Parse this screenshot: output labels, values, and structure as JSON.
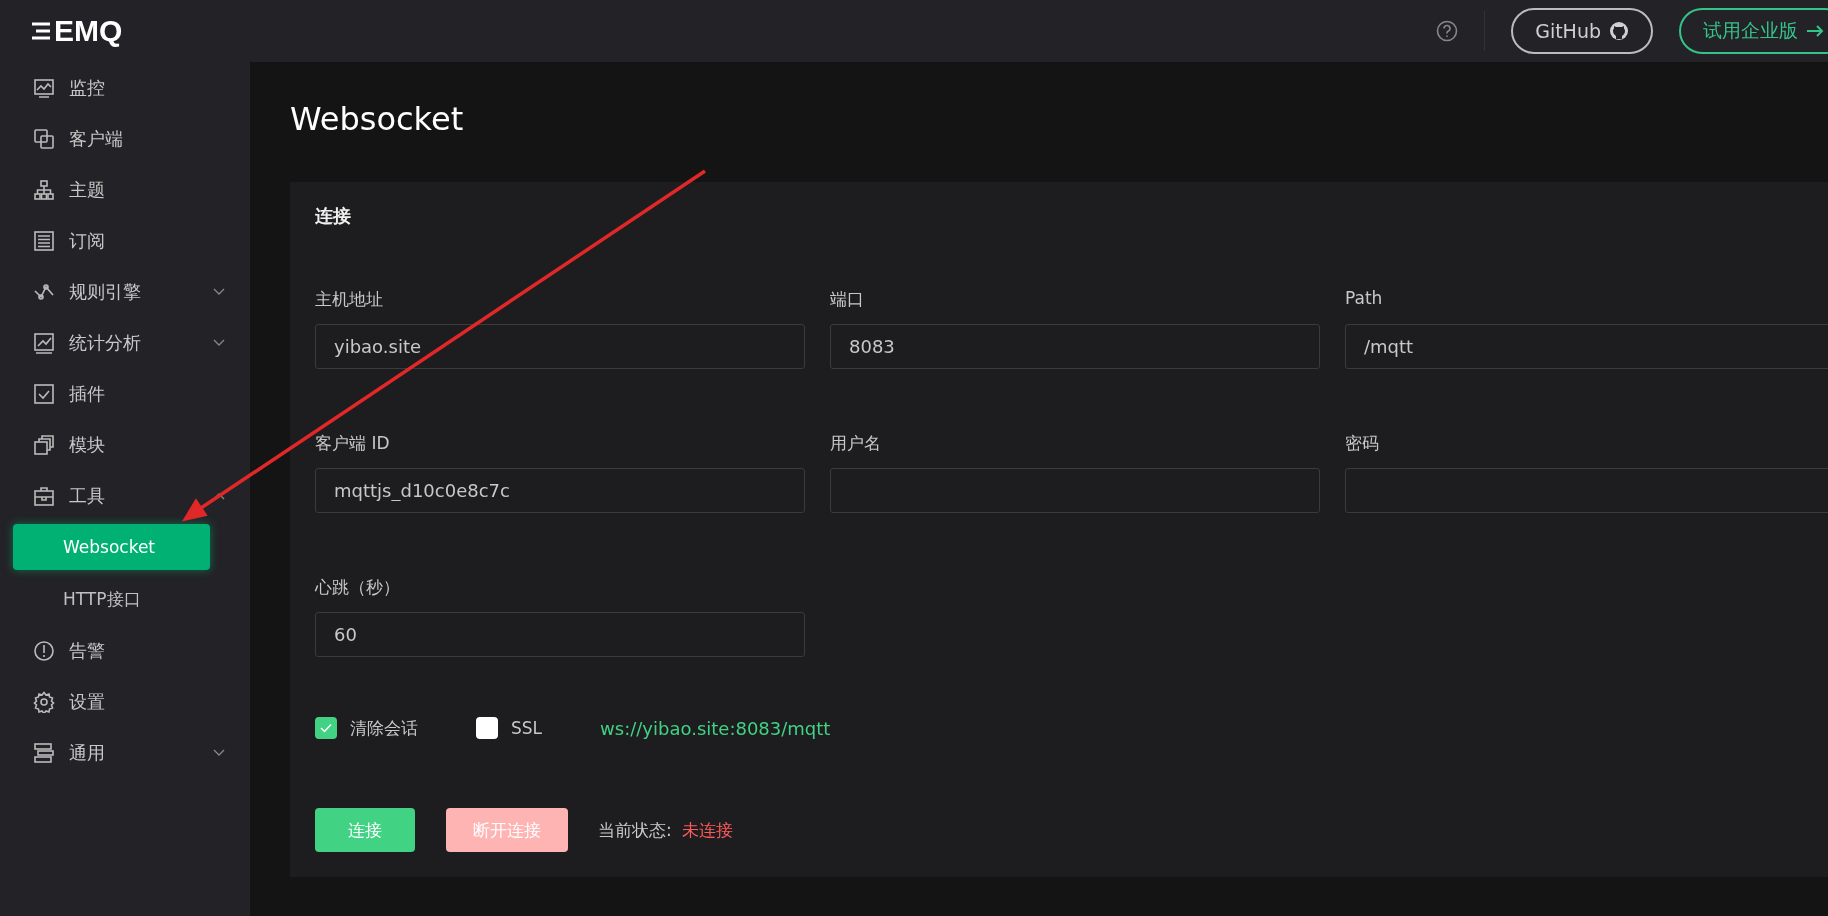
{
  "logo": "EMQ",
  "sidebar": {
    "items": [
      {
        "label": "监控"
      },
      {
        "label": "客户端"
      },
      {
        "label": "主题"
      },
      {
        "label": "订阅"
      },
      {
        "label": "规则引擎",
        "expanded": false
      },
      {
        "label": "统计分析",
        "expanded": false
      },
      {
        "label": "插件"
      },
      {
        "label": "模块"
      },
      {
        "label": "工具",
        "expanded": true,
        "children": [
          {
            "label": "Websocket",
            "selected": true
          },
          {
            "label": "HTTP接口",
            "selected": false
          }
        ]
      },
      {
        "label": "告警"
      },
      {
        "label": "设置"
      },
      {
        "label": "通用",
        "expanded": false
      }
    ]
  },
  "topbar": {
    "github": "GitHub",
    "trial": "试用企业版"
  },
  "page_title": "Websocket",
  "card": {
    "title": "连接",
    "fields": [
      {
        "label": "主机地址",
        "value": "yibao.site"
      },
      {
        "label": "端口",
        "value": "8083"
      },
      {
        "label": "Path",
        "value": "/mqtt"
      },
      {
        "label": "客户端 ID",
        "value": "mqttjs_d10c0e8c7c"
      },
      {
        "label": "用户名"
      },
      {
        "label": "密码"
      },
      {
        "label": "心跳（秒）",
        "value": "60"
      }
    ],
    "options": [
      {
        "label": "清除会话",
        "checked": true
      },
      {
        "label": "SSL",
        "checked": false
      }
    ],
    "url": "ws://yibao.site:8083/mqtt",
    "connect_button": "连接",
    "disconnect_button": "断开连接",
    "status_label": "当前状态:",
    "status_value": "未连接"
  }
}
